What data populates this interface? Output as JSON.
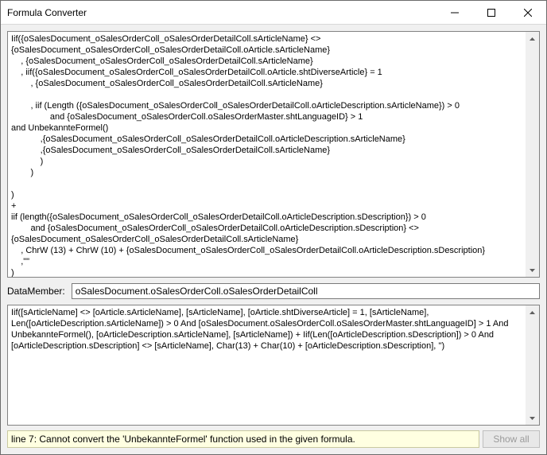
{
  "window": {
    "title": "Formula Converter"
  },
  "topPane": {
    "content": "Iif({oSalesDocument_oSalesOrderColl_oSalesOrderDetailColl.sArticleName} <>\n{oSalesDocument_oSalesOrderColl_oSalesOrderDetailColl.oArticle.sArticleName}\n    , {oSalesDocument_oSalesOrderColl_oSalesOrderDetailColl.sArticleName}\n    , iif({oSalesDocument_oSalesOrderColl_oSalesOrderDetailColl.oArticle.shtDiverseArticle} = 1\n        , {oSalesDocument_oSalesOrderColl_oSalesOrderDetailColl.sArticleName}\n\n        , iif (Length ({oSalesDocument_oSalesOrderColl_oSalesOrderDetailColl.oArticleDescription.sArticleName}) > 0\n                and {oSalesDocument_oSalesOrderColl.oSalesOrderMaster.shtLanguageID} > 1\nand UnbekannteFormel()\n            ,{oSalesDocument_oSalesOrderColl_oSalesOrderDetailColl.oArticleDescription.sArticleName}\n            ,{oSalesDocument_oSalesOrderColl_oSalesOrderDetailColl.sArticleName}\n            )\n        )\n\n)\n+\niif (length({oSalesDocument_oSalesOrderColl_oSalesOrderDetailColl.oArticleDescription.sDescription}) > 0\n        and {oSalesDocument_oSalesOrderColl_oSalesOrderDetailColl.oArticleDescription.sDescription} <>\n{oSalesDocument_oSalesOrderColl_oSalesOrderDetailColl.sArticleName}\n    , ChrW (13) + ChrW (10) + {oSalesDocument_oSalesOrderColl_oSalesOrderDetailColl.oArticleDescription.sDescription}\n    ,\"\"\n)"
  },
  "dataMember": {
    "label": "DataMember:",
    "value": "oSalesDocument.oSalesOrderColl.oSalesOrderDetailColl"
  },
  "midPane": {
    "content": "Iif([sArticleName] <> [oArticle.sArticleName], [sArticleName], [oArticle.shtDiverseArticle] = 1, [sArticleName], Len([oArticleDescription.sArticleName]) > 0 And [oSalesDocument.oSalesOrderColl.oSalesOrderMaster.shtLanguageID] > 1 And UnbekannteFormel(), [oArticleDescription.sArticleName], [sArticleName]) + Iif(Len([oArticleDescription.sDescription]) > 0 And [oArticleDescription.sDescription] <> [sArticleName], Char(13) + Char(10) + [oArticleDescription.sDescription], '')"
  },
  "status": {
    "message": "line 7: Cannot convert the 'UnbekannteFormel' function used in the given formula.",
    "showAllLabel": "Show all"
  }
}
